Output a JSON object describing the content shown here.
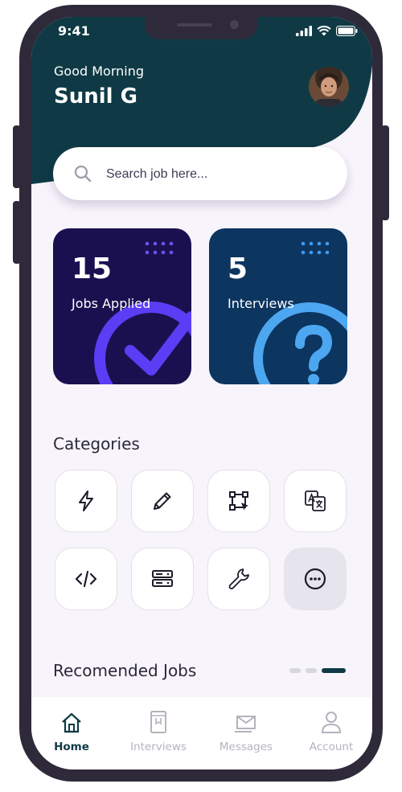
{
  "status_bar": {
    "time": "9:41"
  },
  "header": {
    "greeting": "Good Morning",
    "username": "Sunil G"
  },
  "search": {
    "placeholder": "Search job here..."
  },
  "stats": [
    {
      "value": "15",
      "label": "Jobs Applied",
      "color": "#1a1050",
      "accent": "#5b3df5"
    },
    {
      "value": "5",
      "label": "Interviews",
      "color": "#0c3560",
      "accent": "#4da6f0"
    }
  ],
  "categories": {
    "title": "Categories",
    "items": [
      "lightning-icon",
      "pencil-icon",
      "vector-design-icon",
      "translate-icon",
      "code-icon",
      "server-icon",
      "wrench-icon",
      "more-icon"
    ]
  },
  "recommended": {
    "title": "Recomended Jobs"
  },
  "tabs": [
    {
      "label": "Home",
      "icon": "home-icon",
      "active": true
    },
    {
      "label": "Interviews",
      "icon": "book-icon",
      "active": false
    },
    {
      "label": "Messages",
      "icon": "mail-icon",
      "active": false
    },
    {
      "label": "Account",
      "icon": "user-icon",
      "active": false
    }
  ],
  "colors": {
    "header": "#0f3a45",
    "background": "#f8f4fc",
    "phone_frame": "#2e2a3a"
  }
}
